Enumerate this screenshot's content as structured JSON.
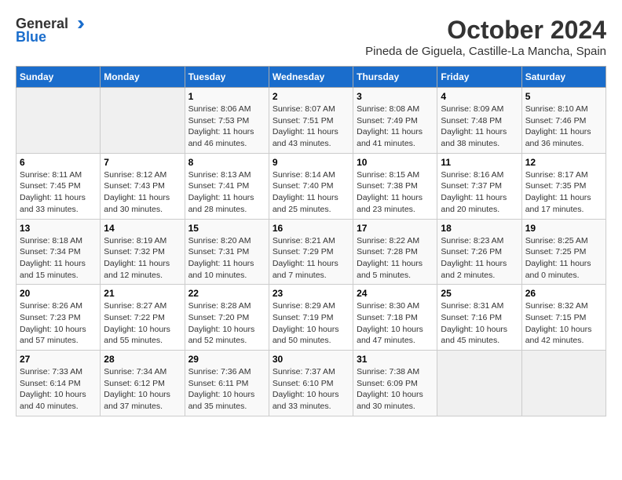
{
  "logo": {
    "general": "General",
    "blue": "Blue"
  },
  "title": "October 2024",
  "location": "Pineda de Giguela, Castille-La Mancha, Spain",
  "headers": [
    "Sunday",
    "Monday",
    "Tuesday",
    "Wednesday",
    "Thursday",
    "Friday",
    "Saturday"
  ],
  "weeks": [
    [
      {
        "num": "",
        "content": ""
      },
      {
        "num": "",
        "content": ""
      },
      {
        "num": "1",
        "content": "Sunrise: 8:06 AM\nSunset: 7:53 PM\nDaylight: 11 hours and 46 minutes."
      },
      {
        "num": "2",
        "content": "Sunrise: 8:07 AM\nSunset: 7:51 PM\nDaylight: 11 hours and 43 minutes."
      },
      {
        "num": "3",
        "content": "Sunrise: 8:08 AM\nSunset: 7:49 PM\nDaylight: 11 hours and 41 minutes."
      },
      {
        "num": "4",
        "content": "Sunrise: 8:09 AM\nSunset: 7:48 PM\nDaylight: 11 hours and 38 minutes."
      },
      {
        "num": "5",
        "content": "Sunrise: 8:10 AM\nSunset: 7:46 PM\nDaylight: 11 hours and 36 minutes."
      }
    ],
    [
      {
        "num": "6",
        "content": "Sunrise: 8:11 AM\nSunset: 7:45 PM\nDaylight: 11 hours and 33 minutes."
      },
      {
        "num": "7",
        "content": "Sunrise: 8:12 AM\nSunset: 7:43 PM\nDaylight: 11 hours and 30 minutes."
      },
      {
        "num": "8",
        "content": "Sunrise: 8:13 AM\nSunset: 7:41 PM\nDaylight: 11 hours and 28 minutes."
      },
      {
        "num": "9",
        "content": "Sunrise: 8:14 AM\nSunset: 7:40 PM\nDaylight: 11 hours and 25 minutes."
      },
      {
        "num": "10",
        "content": "Sunrise: 8:15 AM\nSunset: 7:38 PM\nDaylight: 11 hours and 23 minutes."
      },
      {
        "num": "11",
        "content": "Sunrise: 8:16 AM\nSunset: 7:37 PM\nDaylight: 11 hours and 20 minutes."
      },
      {
        "num": "12",
        "content": "Sunrise: 8:17 AM\nSunset: 7:35 PM\nDaylight: 11 hours and 17 minutes."
      }
    ],
    [
      {
        "num": "13",
        "content": "Sunrise: 8:18 AM\nSunset: 7:34 PM\nDaylight: 11 hours and 15 minutes."
      },
      {
        "num": "14",
        "content": "Sunrise: 8:19 AM\nSunset: 7:32 PM\nDaylight: 11 hours and 12 minutes."
      },
      {
        "num": "15",
        "content": "Sunrise: 8:20 AM\nSunset: 7:31 PM\nDaylight: 11 hours and 10 minutes."
      },
      {
        "num": "16",
        "content": "Sunrise: 8:21 AM\nSunset: 7:29 PM\nDaylight: 11 hours and 7 minutes."
      },
      {
        "num": "17",
        "content": "Sunrise: 8:22 AM\nSunset: 7:28 PM\nDaylight: 11 hours and 5 minutes."
      },
      {
        "num": "18",
        "content": "Sunrise: 8:23 AM\nSunset: 7:26 PM\nDaylight: 11 hours and 2 minutes."
      },
      {
        "num": "19",
        "content": "Sunrise: 8:25 AM\nSunset: 7:25 PM\nDaylight: 11 hours and 0 minutes."
      }
    ],
    [
      {
        "num": "20",
        "content": "Sunrise: 8:26 AM\nSunset: 7:23 PM\nDaylight: 10 hours and 57 minutes."
      },
      {
        "num": "21",
        "content": "Sunrise: 8:27 AM\nSunset: 7:22 PM\nDaylight: 10 hours and 55 minutes."
      },
      {
        "num": "22",
        "content": "Sunrise: 8:28 AM\nSunset: 7:20 PM\nDaylight: 10 hours and 52 minutes."
      },
      {
        "num": "23",
        "content": "Sunrise: 8:29 AM\nSunset: 7:19 PM\nDaylight: 10 hours and 50 minutes."
      },
      {
        "num": "24",
        "content": "Sunrise: 8:30 AM\nSunset: 7:18 PM\nDaylight: 10 hours and 47 minutes."
      },
      {
        "num": "25",
        "content": "Sunrise: 8:31 AM\nSunset: 7:16 PM\nDaylight: 10 hours and 45 minutes."
      },
      {
        "num": "26",
        "content": "Sunrise: 8:32 AM\nSunset: 7:15 PM\nDaylight: 10 hours and 42 minutes."
      }
    ],
    [
      {
        "num": "27",
        "content": "Sunrise: 7:33 AM\nSunset: 6:14 PM\nDaylight: 10 hours and 40 minutes."
      },
      {
        "num": "28",
        "content": "Sunrise: 7:34 AM\nSunset: 6:12 PM\nDaylight: 10 hours and 37 minutes."
      },
      {
        "num": "29",
        "content": "Sunrise: 7:36 AM\nSunset: 6:11 PM\nDaylight: 10 hours and 35 minutes."
      },
      {
        "num": "30",
        "content": "Sunrise: 7:37 AM\nSunset: 6:10 PM\nDaylight: 10 hours and 33 minutes."
      },
      {
        "num": "31",
        "content": "Sunrise: 7:38 AM\nSunset: 6:09 PM\nDaylight: 10 hours and 30 minutes."
      },
      {
        "num": "",
        "content": ""
      },
      {
        "num": "",
        "content": ""
      }
    ]
  ]
}
